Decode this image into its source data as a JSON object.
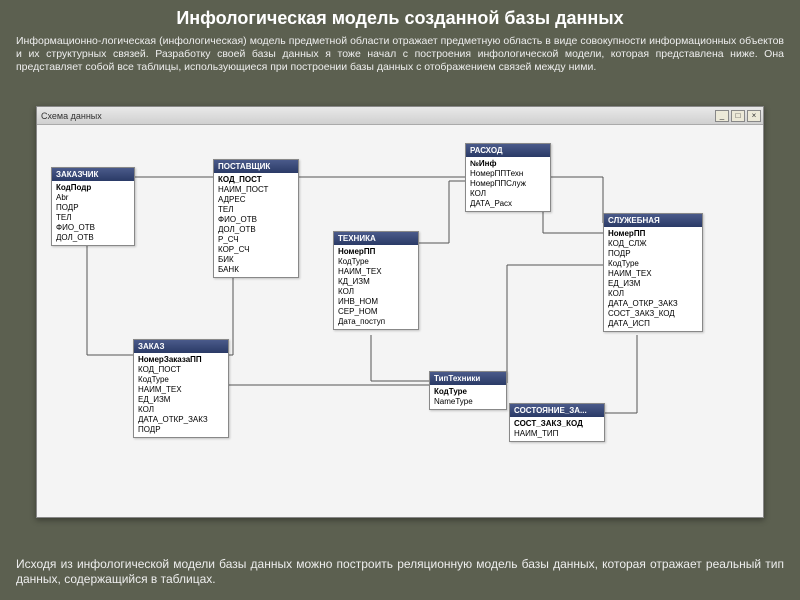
{
  "title": "Инфологическая модель созданной базы данных",
  "intro": "Информационно-логическая (инфологическая) модель предметной области отражает предметную область в виде совокупности информационных объектов и их структурных связей. Разработку своей базы данных я тоже начал с построения инфологической модели, которая представлена ниже. Она представляет собой все таблицы, использующиеся при построении базы данных с отображением связей между ними.",
  "outro": "Исходя из инфологической модели базы данных можно построить реляционную модель базы данных, которая отражает реальный тип данных, содержащийся в таблицах.",
  "window": {
    "title": "Схема данных",
    "min": "_",
    "max": "□",
    "close": "×"
  },
  "entities": {
    "zakazchik": {
      "title": "ЗАКАЗЧИК",
      "fields": [
        "КодПодр",
        "Abr",
        "ПОДР",
        "ТЕЛ",
        "ФИО_ОТВ",
        "ДОЛ_ОТВ"
      ]
    },
    "postavschik": {
      "title": "ПОСТАВЩИК",
      "fields": [
        "КОД_ПОСТ",
        "НАИМ_ПОСТ",
        "АДРЕС",
        "ТЕЛ",
        "ФИО_ОТВ",
        "ДОЛ_ОТВ",
        "Р_СЧ",
        "КОР_СЧ",
        "БИК",
        "БАНК"
      ]
    },
    "rashod": {
      "title": "РАСХОД",
      "fields": [
        "№Инф",
        "НомерППТехн",
        "НомерППСлуж",
        "КОЛ",
        "ДАТА_Расх"
      ]
    },
    "tehnika": {
      "title": "ТЕХНИКА",
      "fields": [
        "НомерПП",
        "КодТуре",
        "НАИМ_ТЕХ",
        "КД_ИЗМ",
        "КОЛ",
        "ИНВ_НОМ",
        "СЕР_НОМ",
        "Дата_поступ"
      ]
    },
    "sluzhebnaya": {
      "title": "СЛУЖЕБНАЯ",
      "fields": [
        "НомерПП",
        "КОД_СЛЖ",
        "ПОДР",
        "КодТуре",
        "НАИМ_ТЕХ",
        "ЕД_ИЗМ",
        "КОЛ",
        "ДАТА_ОТКР_ЗАКЗ",
        "СОСТ_ЗАКЗ_КОД",
        "ДАТА_ИСП"
      ]
    },
    "zakaz": {
      "title": "ЗАКАЗ",
      "fields": [
        "НомерЗаказаПП",
        "КОД_ПОСТ",
        "КодТуре",
        "НАИМ_ТЕХ",
        "ЕД_ИЗМ",
        "КОЛ",
        "ДАТА_ОТКР_ЗАКЗ",
        "ПОДР"
      ]
    },
    "tiptehniki": {
      "title": "ТипТехники",
      "fields": [
        "КодТуре",
        "NameType"
      ]
    },
    "sostoyanie": {
      "title": "СОСТОЯНИЕ_ЗА...",
      "fields": [
        "СОСТ_ЗАКЗ_КОД",
        "НАИМ_ТИП"
      ]
    }
  }
}
